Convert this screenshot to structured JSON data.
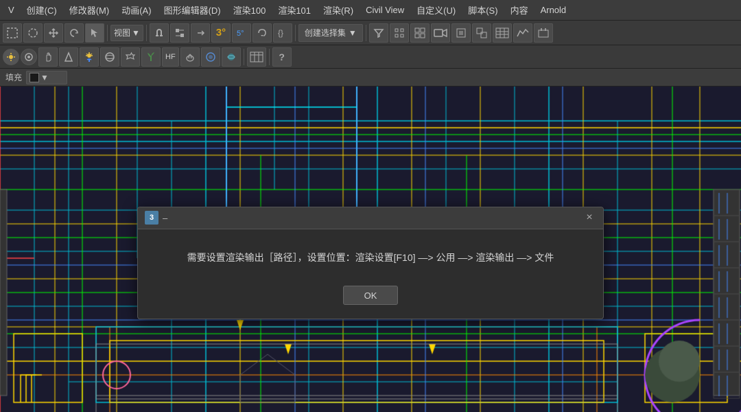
{
  "menubar": {
    "items": [
      {
        "label": "V",
        "key": "v"
      },
      {
        "label": "创建(C)",
        "key": "create"
      },
      {
        "label": "修改器(M)",
        "key": "modifier"
      },
      {
        "label": "动画(A)",
        "key": "animation"
      },
      {
        "label": "图形编辑器(D)",
        "key": "graph_editor"
      },
      {
        "label": "渲染100",
        "key": "render100"
      },
      {
        "label": "渲染101",
        "key": "render101"
      },
      {
        "label": "渲染(R)",
        "key": "render"
      },
      {
        "label": "Civil View",
        "key": "civil_view"
      },
      {
        "label": "自定义(U)",
        "key": "customize"
      },
      {
        "label": "脚本(S)",
        "key": "script"
      },
      {
        "label": "内容",
        "key": "content"
      },
      {
        "label": "Arnold",
        "key": "arnold"
      }
    ]
  },
  "toolbar1": {
    "view_dropdown": "视图",
    "create_selection_label": "创建选择集",
    "icons": [
      "undo",
      "redo",
      "select",
      "move",
      "rotate",
      "scale",
      "link",
      "unlink",
      "bind",
      "camera",
      "light",
      "geo",
      "snap",
      "angle",
      "percent",
      "spinner"
    ]
  },
  "toolbar2": {
    "icons": [
      "arrow",
      "circle",
      "hand",
      "cone",
      "sun",
      "sphere",
      "plane",
      "grid",
      "target",
      "settings",
      "plant",
      "hf",
      "smoke",
      "ocean",
      "info"
    ]
  },
  "fillbar": {
    "label": "填充",
    "dropdown_value": "■",
    "arrow": "▼"
  },
  "dialog": {
    "icon_label": "3",
    "title": "–",
    "close_btn": "×",
    "message": "需要设置渲染输出［路径］，设置位置：渲染设置[F10] —> 公用 —> 渲染输出 —> 文件",
    "ok_label": "OK"
  },
  "colors": {
    "accent_cyan": "#00bcd4",
    "accent_yellow": "#ffd700",
    "accent_magenta": "#ff00ff",
    "accent_green": "#00ff00",
    "accent_red": "#ff4444",
    "accent_orange": "#ff8800",
    "bg_dark": "#1a1a2e",
    "toolbar_bg": "#3a3a3a",
    "dialog_bg": "#2d2d2d"
  }
}
